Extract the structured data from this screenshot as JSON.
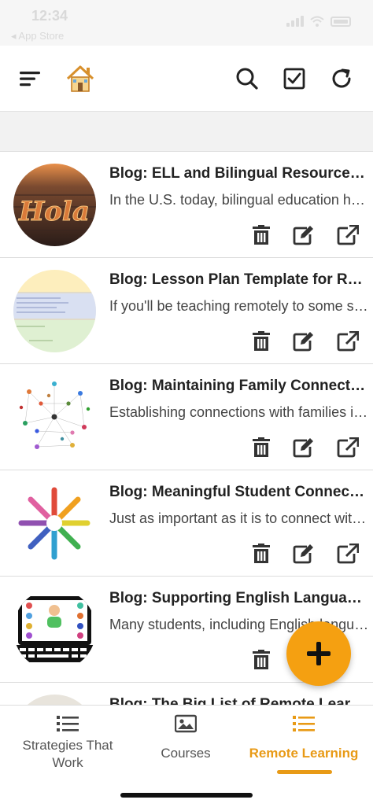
{
  "status": {
    "time": "12:34",
    "back_label": "◂ App Store"
  },
  "toolbar": {
    "icons": [
      "menu-icon",
      "home-icon",
      "search-icon",
      "checkbox-icon",
      "refresh-icon"
    ]
  },
  "items": [
    {
      "title": "Blog: ELL and Bilingual Resources for Remote Learning",
      "desc": "In the U.S. today, bilingual education has been",
      "thumb": "Hola"
    },
    {
      "title": "Blog: Lesson Plan Template for Remote Learning",
      "desc": "If you'll be teaching remotely to some students",
      "thumb": "lesson-plan-doc"
    },
    {
      "title": "Blog: Maintaining Family Connections",
      "desc": "Establishing connections with families is key",
      "thumb": "people-network"
    },
    {
      "title": "Blog: Meaningful Student Connections",
      "desc": "Just as important as it is to connect with families",
      "thumb": "hands-circle"
    },
    {
      "title": "Blog: Supporting English Language Learners",
      "desc": "Many students, including English language learners",
      "thumb": "video-call-laptop"
    },
    {
      "title": "Blog: The Big List of Remote Learning Resources",
      "desc": "",
      "thumb": "partial"
    }
  ],
  "tabs": [
    {
      "label": "Strategies That Work",
      "icon": "list-icon",
      "active": false
    },
    {
      "label": "Courses",
      "icon": "image-icon",
      "active": false
    },
    {
      "label": "Remote Learning",
      "icon": "list-icon",
      "active": true
    }
  ],
  "colors": {
    "accent": "#f5a011",
    "active_tab": "#e89a16",
    "icon": "#333333"
  }
}
